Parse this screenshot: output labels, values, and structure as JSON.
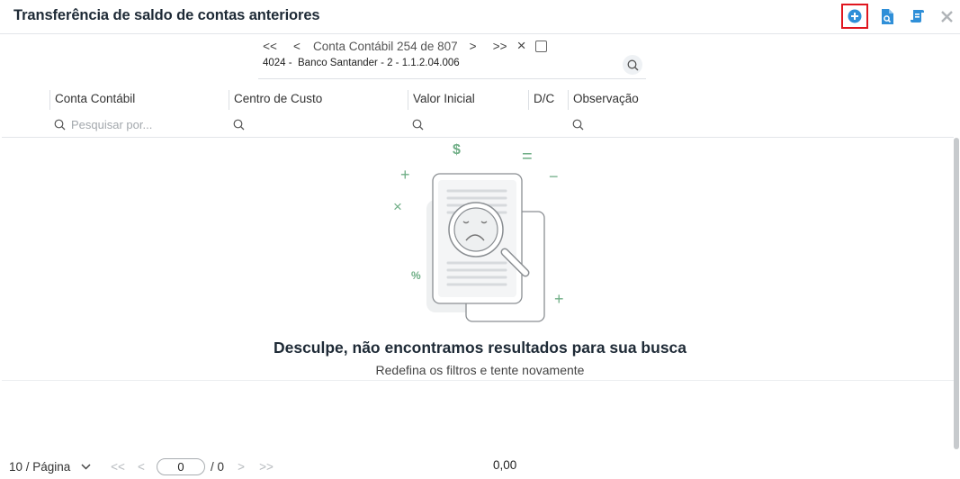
{
  "window": {
    "title": "Transferência de saldo de contas anteriores"
  },
  "navigator": {
    "label": "Conta Contábil 254 de 807",
    "first_icon": "double-chevron-left-icon",
    "prev_icon": "chevron-left-icon",
    "next_icon": "chevron-right-icon",
    "last_icon": "double-chevron-right-icon",
    "clear_icon": "close-icon",
    "first": "<<",
    "prev": "<",
    "next": ">",
    "last": ">>",
    "clear": "×"
  },
  "account": {
    "text": "4024 -  Banco Santander - 2 - 1.1.2.04.006"
  },
  "columns": [
    {
      "label": "Conta Contábil",
      "placeholder": "Pesquisar por..."
    },
    {
      "label": "Centro de Custo",
      "placeholder": ""
    },
    {
      "label": "Valor Inicial",
      "placeholder": ""
    },
    {
      "label": "D/C",
      "placeholder": ""
    },
    {
      "label": "Observação",
      "placeholder": ""
    }
  ],
  "empty": {
    "title": "Desculpe, não encontramos resultados para sua busca",
    "subtitle": "Redefina os filtros e tente novamente",
    "symbols": {
      "dollar": "$",
      "equals": "=",
      "minus": "−",
      "plus": "+",
      "times": "×",
      "percent": "%"
    }
  },
  "footer": {
    "page_size": "10 / Página",
    "first": "<<",
    "prev": "<",
    "next": ">",
    "last": ">>",
    "current_page": "0",
    "total_pages": "/ 0",
    "total_value": "0,00"
  },
  "colors": {
    "accent": "#2f8fd8",
    "highlight": "#e0161f",
    "illustration_green": "#6fae86"
  }
}
